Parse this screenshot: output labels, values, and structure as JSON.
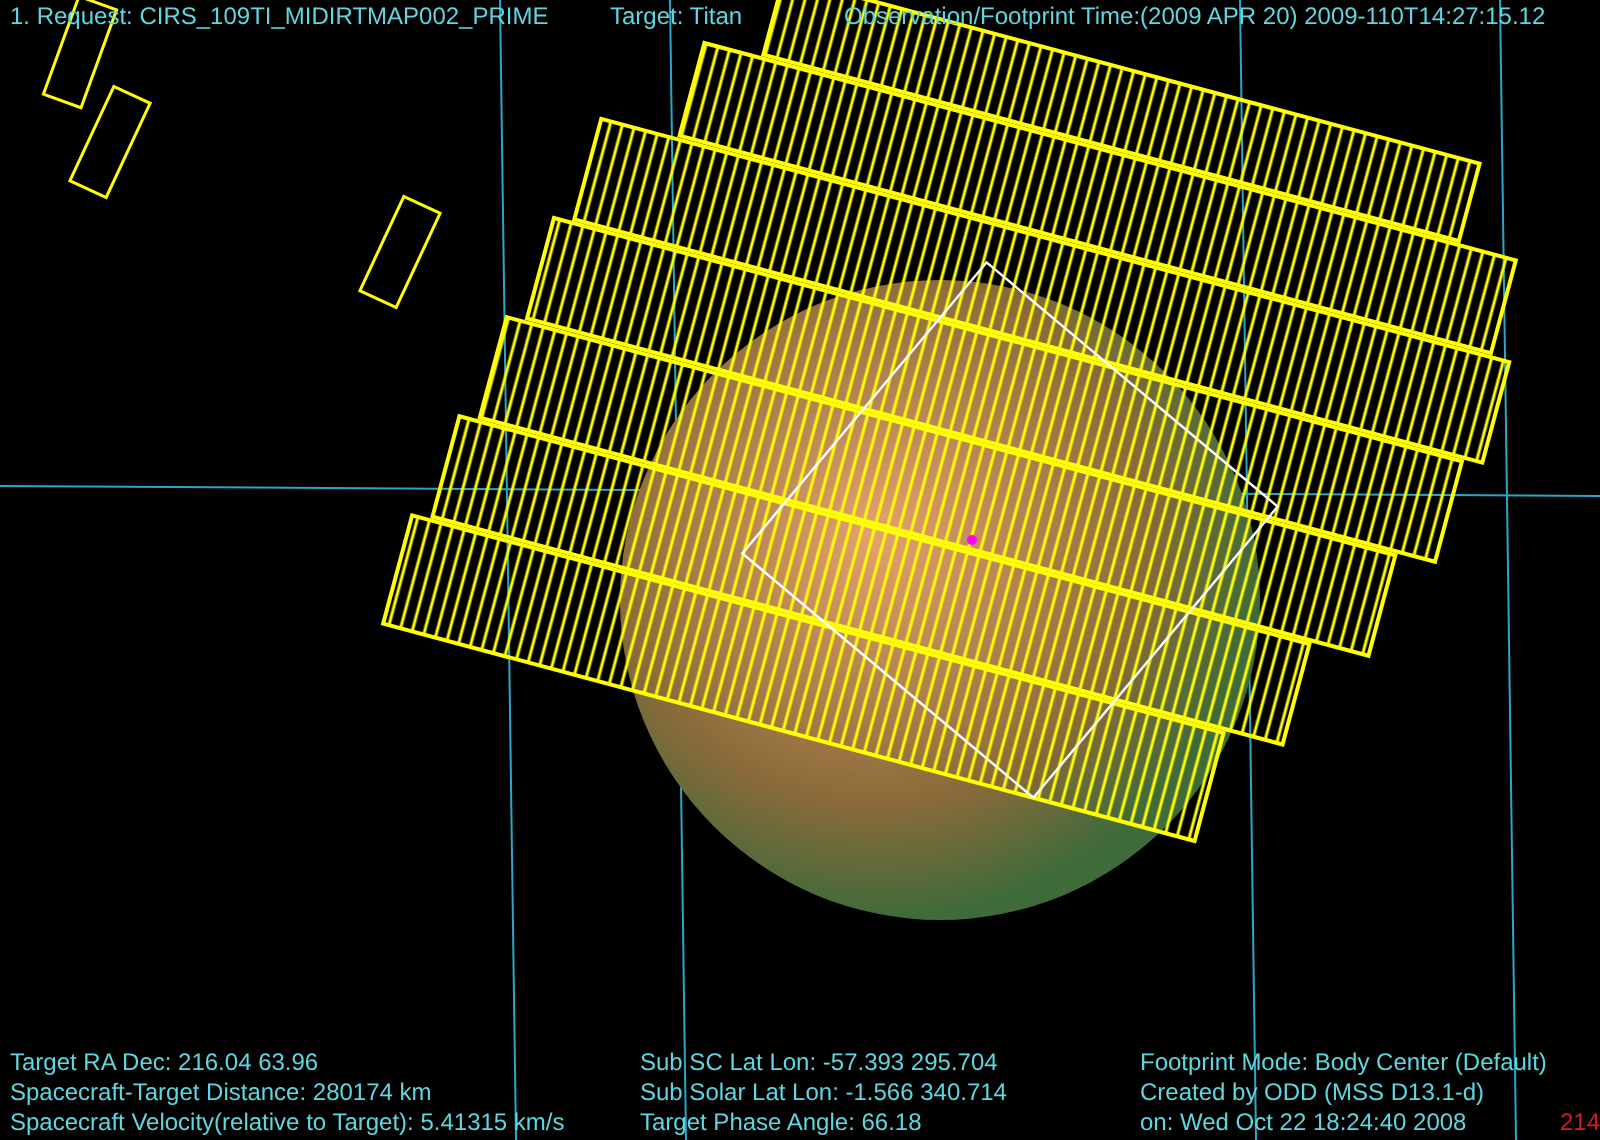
{
  "header": {
    "request": "1. Request: CIRS_109TI_MIDIRTMAP002_PRIME",
    "target": "Target: Titan",
    "time": "Observation/Footprint Time:(2009 APR 20) 2009-110T14:27:15.12"
  },
  "footer": {
    "columns": [
      [
        "Target RA Dec: 216.04   63.96",
        "Spacecraft-Target Distance:  280174 km",
        "Spacecraft Velocity(relative to Target): 5.41315 km/s"
      ],
      [
        "Sub SC Lat Lon: -57.393  295.704",
        "Sub Solar Lat Lon: -1.566  340.714",
        "Target Phase Angle: 66.18"
      ],
      [
        "Footprint Mode: Body Center (Default)",
        "Created by ODD (MSS D13.1-d)",
        "on: Wed Oct 22 18:24:40 2008"
      ]
    ]
  },
  "marker_label": "214"
}
